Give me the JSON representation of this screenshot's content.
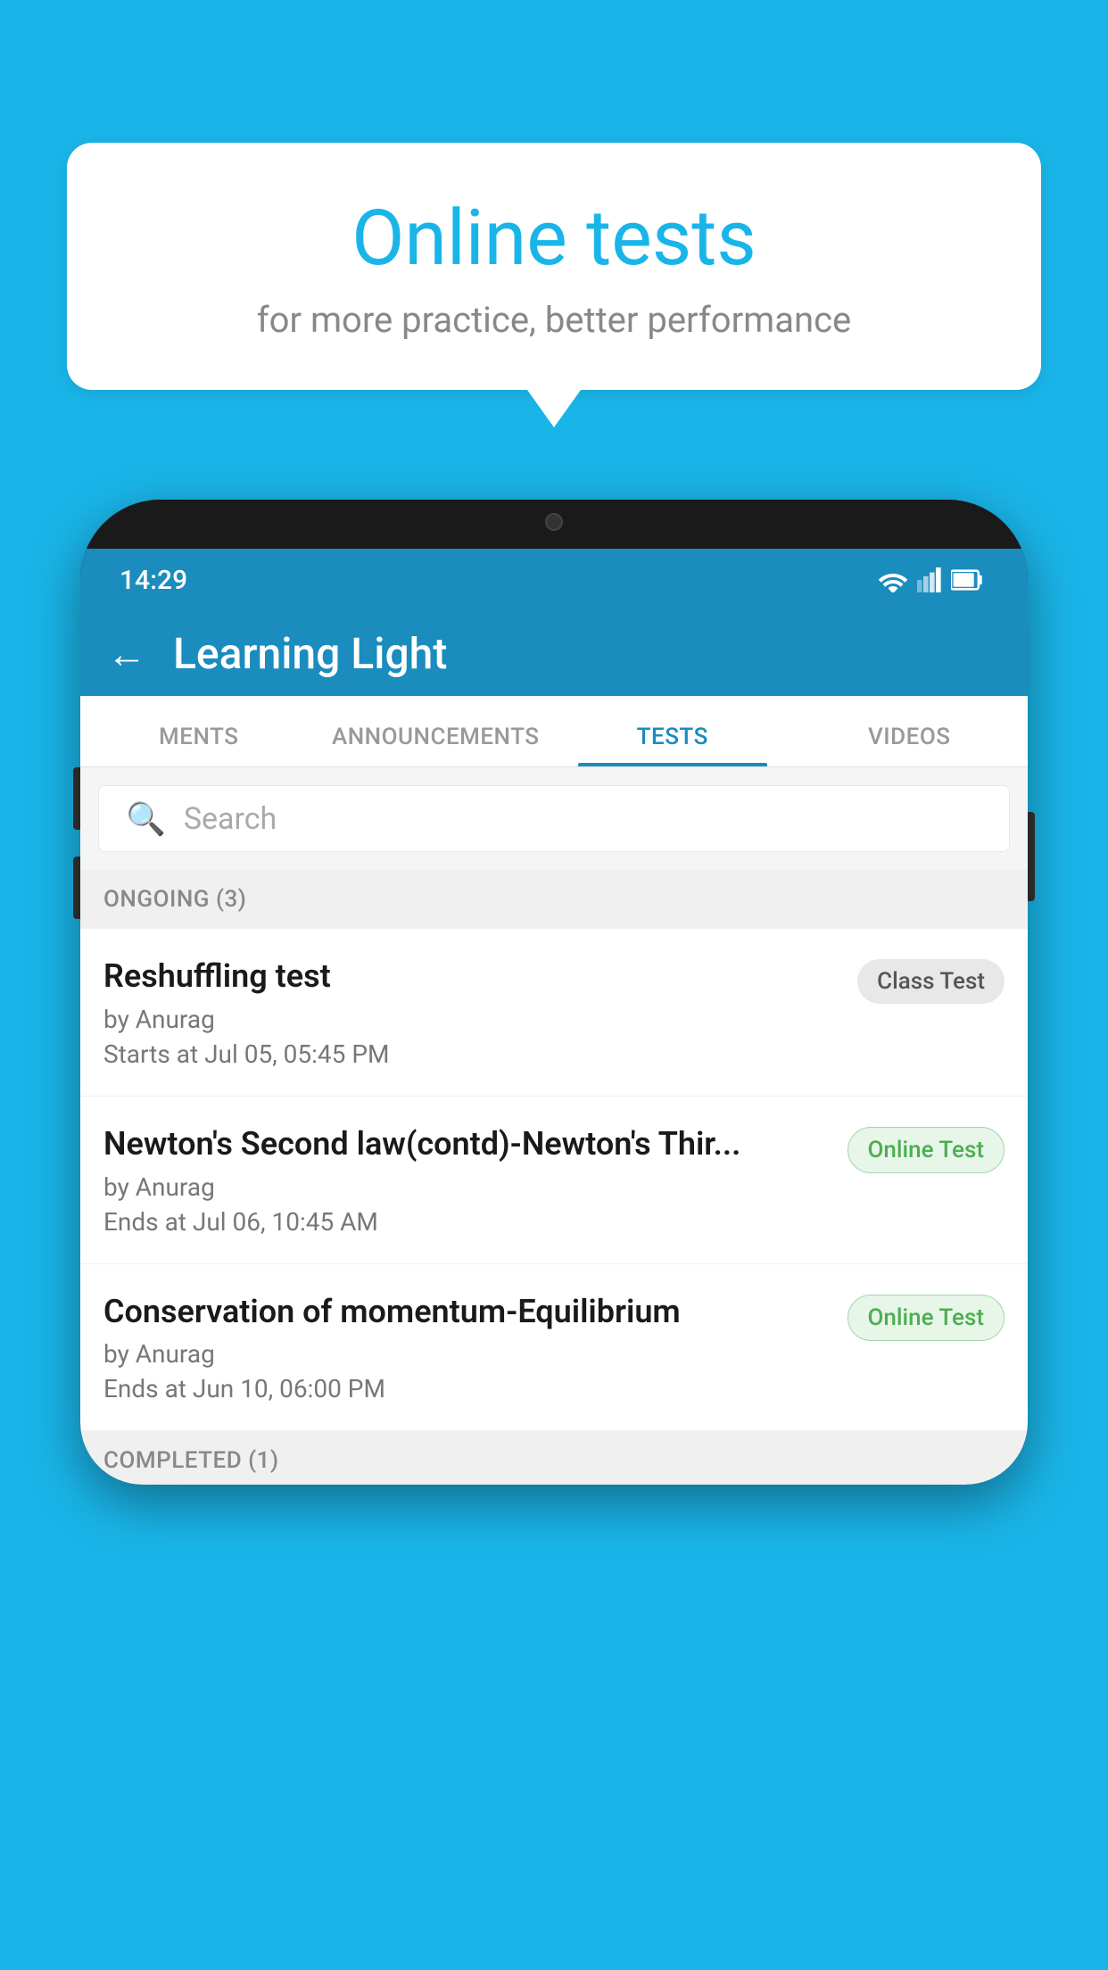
{
  "background": {
    "color": "#1ab5e8"
  },
  "speech_bubble": {
    "title": "Online tests",
    "subtitle": "for more practice, better performance"
  },
  "phone": {
    "status_bar": {
      "time": "14:29"
    },
    "app_bar": {
      "title": "Learning Light",
      "back_label": "←"
    },
    "tabs": [
      {
        "label": "MENTS",
        "active": false
      },
      {
        "label": "ANNOUNCEMENTS",
        "active": false
      },
      {
        "label": "TESTS",
        "active": true
      },
      {
        "label": "VIDEOS",
        "active": false
      }
    ],
    "search": {
      "placeholder": "Search"
    },
    "ongoing_section": {
      "title": "ONGOING (3)"
    },
    "tests": [
      {
        "name": "Reshuffling test",
        "author": "by Anurag",
        "date": "Starts at  Jul 05, 05:45 PM",
        "badge": "Class Test",
        "badge_type": "class"
      },
      {
        "name": "Newton's Second law(contd)-Newton's Thir...",
        "author": "by Anurag",
        "date": "Ends at  Jul 06, 10:45 AM",
        "badge": "Online Test",
        "badge_type": "online"
      },
      {
        "name": "Conservation of momentum-Equilibrium",
        "author": "by Anurag",
        "date": "Ends at  Jun 10, 06:00 PM",
        "badge": "Online Test",
        "badge_type": "online"
      }
    ],
    "completed_section": {
      "title": "COMPLETED (1)"
    }
  }
}
